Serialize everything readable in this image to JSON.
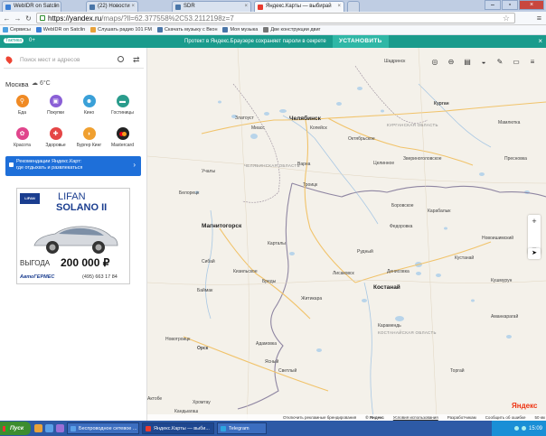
{
  "browser": {
    "tabs": [
      {
        "title": "WebIDR on Satclin",
        "active": false,
        "icon_color": "#3b7ed4"
      },
      {
        "title": "(22) Новости",
        "active": false,
        "icon_color": "#4a76a8"
      },
      {
        "title": "SDR",
        "active": false,
        "icon_color": "#4a76a8"
      },
      {
        "title": "Яндекс.Карты — выбирай",
        "active": true,
        "icon_color": "#e83b2f"
      }
    ],
    "address": {
      "host": "https://yandex.ru",
      "path": "/maps/?ll=62.377558%2C53.2112198z=7"
    },
    "bookmarks": [
      {
        "label": "Сервисы",
        "icon_color": "#4ea1e0"
      },
      {
        "label": "WebIDR on Satclin",
        "icon_color": "#3b7ed4"
      },
      {
        "label": "Слушать радио 101 FM",
        "icon_color": "#e8a23a"
      },
      {
        "label": "Скачать музыку с Вкон",
        "icon_color": "#4a76a8"
      },
      {
        "label": "Моя музыка",
        "icon_color": "#4a76a8"
      },
      {
        "label": "Две конструкции двиг",
        "icon_color": "#777777"
      }
    ]
  },
  "yandex_bar": {
    "city_pill": "Тактика",
    "count": "0+",
    "message": "Протект в Яндекс.Браузере сохраняет пароли в секрете",
    "install": "УСТАНОВИТЬ"
  },
  "panel": {
    "search_placeholder": "Поиск мест и адресов",
    "city": "Москва",
    "weather": "6°C",
    "categories": [
      {
        "label": "Еда",
        "color": "#f08a24",
        "icon": "fork-knife-icon",
        "glyph": "🍴"
      },
      {
        "label": "Покупки",
        "color": "#8a5fd6",
        "icon": "shopping-bag-icon",
        "glyph": "⊡"
      },
      {
        "label": "Кино",
        "color": "#3aa0d8",
        "icon": "cinema-icon",
        "glyph": "☺"
      },
      {
        "label": "Гостиницы",
        "color": "#2a9c8c",
        "icon": "bed-icon",
        "glyph": "▬"
      },
      {
        "label": "Красота",
        "color": "#e0458c",
        "icon": "beauty-icon",
        "glyph": "✿"
      },
      {
        "label": "Здоровье",
        "color": "#e54646",
        "icon": "health-icon",
        "glyph": "✚"
      },
      {
        "label": "Бургер Кинг",
        "color": "#f0a030",
        "icon": "burger-king-icon",
        "glyph": "◗"
      },
      {
        "label": "Mastercard",
        "color": "#222222",
        "icon": "mastercard-icon",
        "glyph": "●"
      }
    ],
    "rec_line1": "Рекомендации Яндекс.Карт:",
    "rec_line2": "где отдыхать и развлекаться",
    "ad": {
      "brand": "LIFAN",
      "model_line1": "LIFAN",
      "model_line2": "SOLANO II",
      "price_label": "ВЫГОДА",
      "price": "200 000 ₽",
      "dealer": "АвтоГЕРМЕС",
      "phone": "(495) 663 17 84"
    }
  },
  "map": {
    "toolbar_icons": [
      "layers-icon",
      "car-icon",
      "bus-icon",
      "hybrid-icon",
      "ruler-icon",
      "print-icon",
      "menu-icon"
    ],
    "labels": [
      {
        "text": "Челябинск",
        "big": true
      },
      {
        "text": "Магнитогорск",
        "big": false
      },
      {
        "text": "Костанай",
        "big": true
      },
      {
        "text": "Курган",
        "big": false
      },
      {
        "text": "Орск",
        "big": false
      },
      {
        "text": "Троицк",
        "big": false
      },
      {
        "text": "Рудный",
        "big": false
      },
      {
        "text": "Карталы",
        "big": false
      },
      {
        "text": "Лисаковск",
        "big": false
      },
      {
        "text": "Житикара",
        "big": false
      },
      {
        "text": "Карабалык",
        "big": false
      },
      {
        "text": "Шадринск",
        "big": false
      },
      {
        "text": "Кустанай",
        "big": false
      },
      {
        "text": "Светлый",
        "big": false
      },
      {
        "text": "Актобе",
        "big": false
      },
      {
        "text": "Хромтау",
        "big": false
      },
      {
        "text": "Кандыагаш",
        "big": false
      },
      {
        "text": "Сибай",
        "big": false
      },
      {
        "text": "Учалы",
        "big": false
      },
      {
        "text": "Белорецк",
        "big": false
      },
      {
        "text": "Миасс",
        "big": false
      },
      {
        "text": "Златоуст",
        "big": false
      },
      {
        "text": "Копейск",
        "big": false
      },
      {
        "text": "Октябрьское",
        "big": false
      },
      {
        "text": "Целинное",
        "big": false
      },
      {
        "text": "Звериноголовское",
        "big": false
      },
      {
        "text": "Пресновка",
        "big": false
      },
      {
        "text": "Новоишимский",
        "big": false
      },
      {
        "text": "Денисовка",
        "big": false
      },
      {
        "text": "Карамендь",
        "big": false
      },
      {
        "text": "Аманкарагай",
        "big": false
      },
      {
        "text": "Торгай",
        "big": false
      },
      {
        "text": "Кушмурун",
        "big": false
      },
      {
        "text": "Федоровка",
        "big": false
      },
      {
        "text": "Боровское",
        "big": false
      },
      {
        "text": "Мамлютка",
        "big": false
      },
      {
        "text": "Баймак",
        "big": false
      },
      {
        "text": "Адамовка",
        "big": false
      },
      {
        "text": "Ясный",
        "big": false
      },
      {
        "text": "Бреды",
        "big": false
      },
      {
        "text": "Варна",
        "big": false
      },
      {
        "text": "Кизильское",
        "big": false
      },
      {
        "text": "Новотроицк",
        "big": false
      }
    ],
    "regions": [
      "ЧЕЛЯБИНСКАЯ ОБЛАСТЬ",
      "КУРГАНСКАЯ ОБЛАСТЬ",
      "КОСТАНАЙСКАЯ ОБЛАСТЬ"
    ],
    "logo": "Яндекс",
    "footer": {
      "item1": "Отключить рекламные брендирования",
      "item2": "© Яндекс",
      "item3": "Условия использования",
      "item4": "Разработчикам",
      "item5": "Сообщить об ошибке",
      "scale": "50 км"
    }
  },
  "taskbar": {
    "start": "Пуск",
    "items": [
      {
        "title": "Беспроводное сетевое ...",
        "active": false,
        "icon_color": "#5aa0e8"
      },
      {
        "title": "Яндекс.Карты — выби...",
        "active": true,
        "icon_color": "#e83b2f"
      },
      {
        "title": "Telegram",
        "active": false,
        "icon_color": "#2ca5e0"
      }
    ],
    "clock": "15:09"
  }
}
